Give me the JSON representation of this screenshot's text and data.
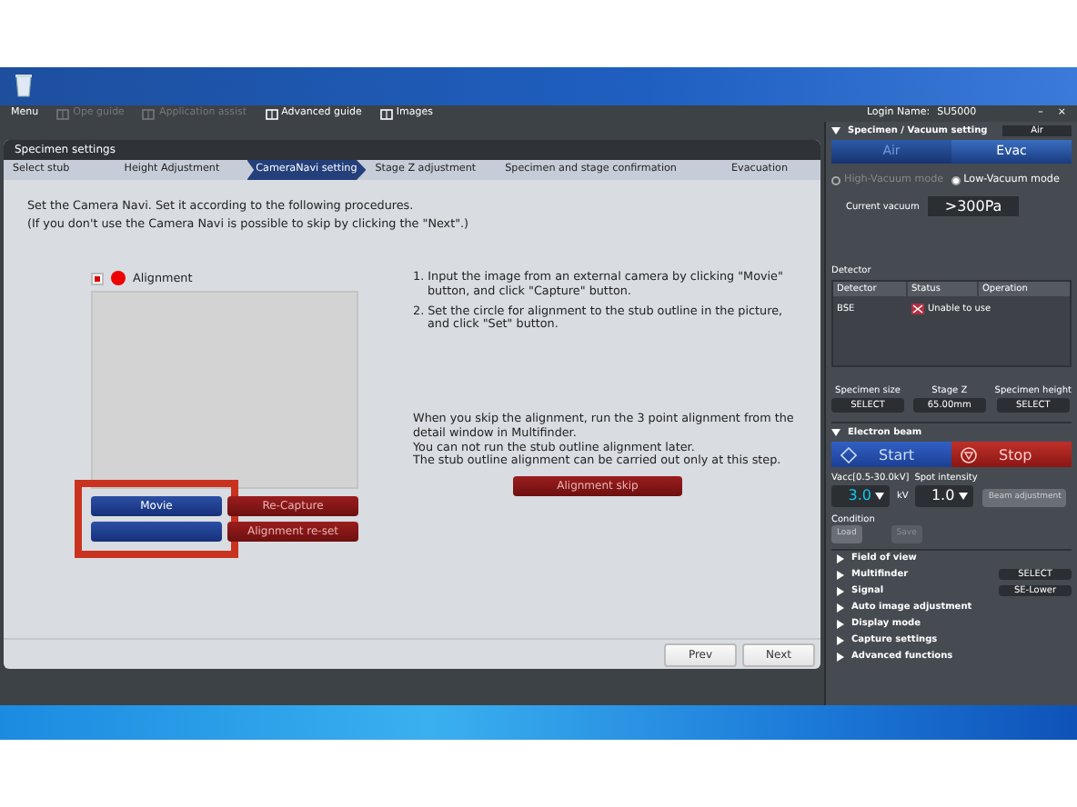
{
  "menu": [
    {
      "label": "Menu",
      "disabled": false
    },
    {
      "label": "Ope guide",
      "disabled": true
    },
    {
      "label": "Application assist",
      "disabled": true
    },
    {
      "label": "Advanced guide",
      "disabled": false
    },
    {
      "label": "Images",
      "disabled": false
    }
  ],
  "login": {
    "label": "Login Name:",
    "value": "SU5000"
  },
  "window_controls": [
    "–",
    "×"
  ],
  "specimen_settings": {
    "title": "Specimen settings",
    "steps": [
      {
        "label": "Select stub",
        "selected": false
      },
      {
        "label": "Height Adjustment",
        "selected": false
      },
      {
        "label": "CameraNavi setting",
        "selected": true
      },
      {
        "label": "Stage Z adjustment",
        "selected": false
      },
      {
        "label": "Specimen and stage confirmation",
        "selected": false
      },
      {
        "label": "Evacuation",
        "selected": false
      }
    ],
    "intro": [
      "Set the Camera Navi. Set it according to the following procedures.",
      "(If you don't use the Camera Navi is possible to skip by clicking the \"Next\".)"
    ],
    "alignment": {
      "label": "Alignment",
      "checked": true
    },
    "button_columns": [
      {
        "highlighted": true,
        "buttons": [
          {
            "label": "Movie",
            "kind": "primary"
          },
          {
            "kind": "primary"
          }
        ]
      },
      {
        "highlighted": false,
        "buttons": [
          {
            "label": "Re-Capture",
            "kind": "danger"
          },
          {
            "label": "Alignment re-set",
            "kind": "danger"
          }
        ]
      }
    ],
    "procedure": [
      "1. Input the image from an external camera by clicking \"Movie\" button, and click \"Capture\" button.",
      "2. Set the circle for alignment to the stub outline in the picture, and click \"Set\" button."
    ],
    "skip_note": [
      "When you skip the alignment, run the 3 point alignment from the detail window in Multifinder.",
      "You can not run the stub outline alignment later.",
      "The stub outline alignment can be carried out only at this step."
    ],
    "skip_button": "Alignment skip",
    "nav_buttons": [
      "Prev",
      "Next"
    ]
  },
  "vacuum": {
    "title": "Specimen / Vacuum setting",
    "status": "Air",
    "toggle": [
      {
        "label": "Air",
        "selected": false
      },
      {
        "label": "Evac",
        "selected": true
      }
    ],
    "modes": [
      {
        "label": "High-Vacuum mode",
        "selected": false
      },
      {
        "label": "Low-Vacuum mode",
        "selected": true
      }
    ],
    "current_label": "Current vacuum",
    "current_value": ">300Pa"
  },
  "detector": {
    "title": "Detector",
    "columns": [
      "Detector",
      "Status",
      "Operation"
    ],
    "rows": [
      {
        "detector": "BSE",
        "status": "Unable to use"
      }
    ]
  },
  "specimen": [
    {
      "label": "Specimen size",
      "value": "SELECT"
    },
    {
      "label": "Stage Z",
      "value": "65.00mm"
    },
    {
      "label": "Specimen height",
      "value": "SELECT"
    }
  ],
  "electron_beam": {
    "title": "Electron beam",
    "start": "Start",
    "stop": "Stop",
    "vacc_label": "Vacc[0.5-30.0kV]",
    "vacc_value": "3.0",
    "vacc_unit": "kV",
    "spot_label": "Spot intensity",
    "spot_value": "1.0",
    "beam_adjust": "Beam adjustment",
    "condition_label": "Condition",
    "load": "Load",
    "save": "Save"
  },
  "sections": [
    {
      "label": "Field of view"
    },
    {
      "label": "Multifinder",
      "value": "SELECT"
    },
    {
      "label": "Signal",
      "value": "SE-Lower"
    },
    {
      "label": "Auto image adjustment"
    },
    {
      "label": "Display mode"
    },
    {
      "label": "Capture settings"
    },
    {
      "label": "Advanced functions"
    }
  ]
}
